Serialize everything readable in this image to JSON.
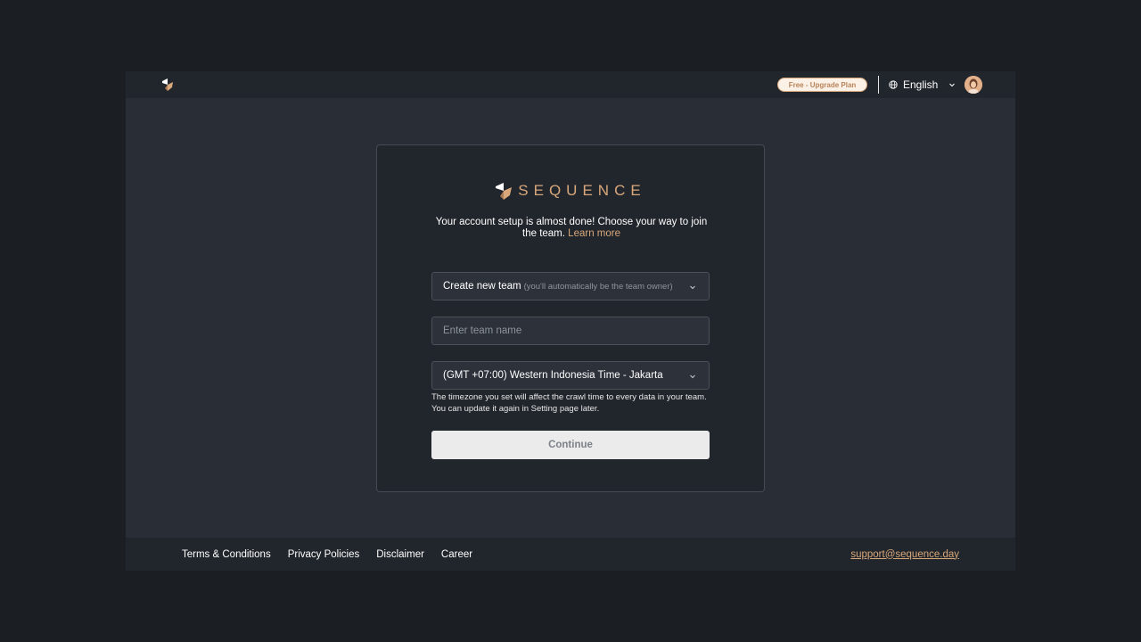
{
  "header": {
    "plan_badge": "Free - Upgrade Plan",
    "language": "English",
    "logo_icon": "sequence-logo-icon",
    "globe_icon": "globe-icon",
    "avatar_icon": "user-avatar"
  },
  "card": {
    "brand_name": "SEQUENCE",
    "intro_text": "Your account setup is almost done! Choose your way to join the team.",
    "learn_more": "Learn more",
    "team_mode": {
      "value": "Create new team",
      "hint": "(you'll automatically be the team owner)"
    },
    "team_name": {
      "placeholder": "Enter team name",
      "value": ""
    },
    "timezone": {
      "value": "(GMT +07:00) Western Indonesia Time - Jakarta"
    },
    "timezone_help": "The timezone you set will affect the crawl time to every data in your team. You can update it again in Setting page later.",
    "continue_label": "Continue"
  },
  "footer": {
    "links": [
      "Terms & Conditions",
      "Privacy Policies",
      "Disclaimer",
      "Career"
    ],
    "support_email": "support@sequence.day"
  },
  "colors": {
    "page_bg": "#1b1e23",
    "app_bg": "#282d36",
    "card_bg": "#21252c",
    "accent": "#d8a87a"
  }
}
